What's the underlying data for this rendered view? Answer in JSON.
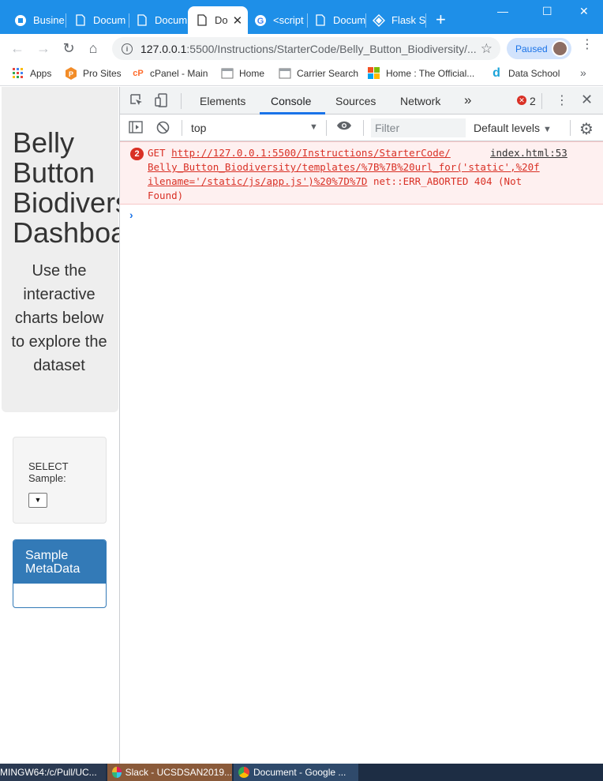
{
  "browser": {
    "tabs": [
      {
        "label": "Busine",
        "icon": "chase-icon",
        "active": false
      },
      {
        "label": "Docum",
        "icon": "document-icon",
        "active": false
      },
      {
        "label": "Docum",
        "icon": "document-icon",
        "active": false
      },
      {
        "label": "Do",
        "icon": "document-icon",
        "active": true
      },
      {
        "label": "<script",
        "icon": "google-icon",
        "active": false
      },
      {
        "label": "Docum",
        "icon": "document-icon",
        "active": false
      },
      {
        "label": "Flask S",
        "icon": "flask-icon",
        "active": false
      }
    ],
    "new_tab_label": "+",
    "window_controls": {
      "minimize": "—",
      "maximize": "☐",
      "close": "✕"
    }
  },
  "toolbar": {
    "url_host": "127.0.0.1",
    "url_path": ":5500/Instructions/StarterCode/Belly_Button_Biodiversity/...",
    "profile_label": "Paused"
  },
  "bookmarks": [
    {
      "label": "Apps",
      "icon": "apps-grid-icon"
    },
    {
      "label": "Pro Sites",
      "icon": "pro-sites-icon"
    },
    {
      "label": "cPanel - Main",
      "icon": "cpanel-icon"
    },
    {
      "label": "Home",
      "icon": "page-icon"
    },
    {
      "label": "Carrier Search",
      "icon": "page-icon"
    },
    {
      "label": "Home : The Official...",
      "icon": "windows-icon"
    },
    {
      "label": "Data School",
      "icon": "data-school-icon"
    }
  ],
  "page": {
    "title": "Belly\nButton\nBiodiversity\nDashboard",
    "subtitle": "Use the interactive charts below to explore the dataset",
    "select_label": "SELECT Sample:",
    "select_value": "",
    "metadata_heading": "Sample MetaData"
  },
  "devtools": {
    "tabs": [
      "Elements",
      "Console",
      "Sources",
      "Network"
    ],
    "active_tab": "Console",
    "more_tabs": "»",
    "error_count": "2",
    "context": "top",
    "filter_placeholder": "Filter",
    "levels": "Default levels",
    "messages": [
      {
        "count": "2",
        "method": "GET",
        "url": "http://127.0.0.1:5500/Instructions/StarterCode/Belly_Button_Biodiversity/templates/%7B%7B%20url_for('static',%20filename='/static/js/app.js')%20%7D%7D",
        "url_line1": "http://127.0.0.1:5500/Instructions/StarterCode/",
        "url_line2": "Belly_Button_Biodiversity/templates/%7B%7B%20url_for('static',%20f",
        "url_line3": "ilename='/static/js/app.js')%20%7D%7D",
        "status": "net::ERR_ABORTED 404 (Not",
        "status2": "Found)",
        "source": "index.html:53"
      }
    ]
  },
  "taskbar": [
    {
      "label": "MINGW64:/c/Pull/UC..."
    },
    {
      "label": "Slack - UCSDSAN2019..."
    },
    {
      "label": "Document - Google ..."
    }
  ],
  "colors": {
    "tabstrip": "#1e8fe8",
    "error_red": "#d93025",
    "panel_blue": "#337ab7",
    "jumbotron": "#eeeeee"
  }
}
